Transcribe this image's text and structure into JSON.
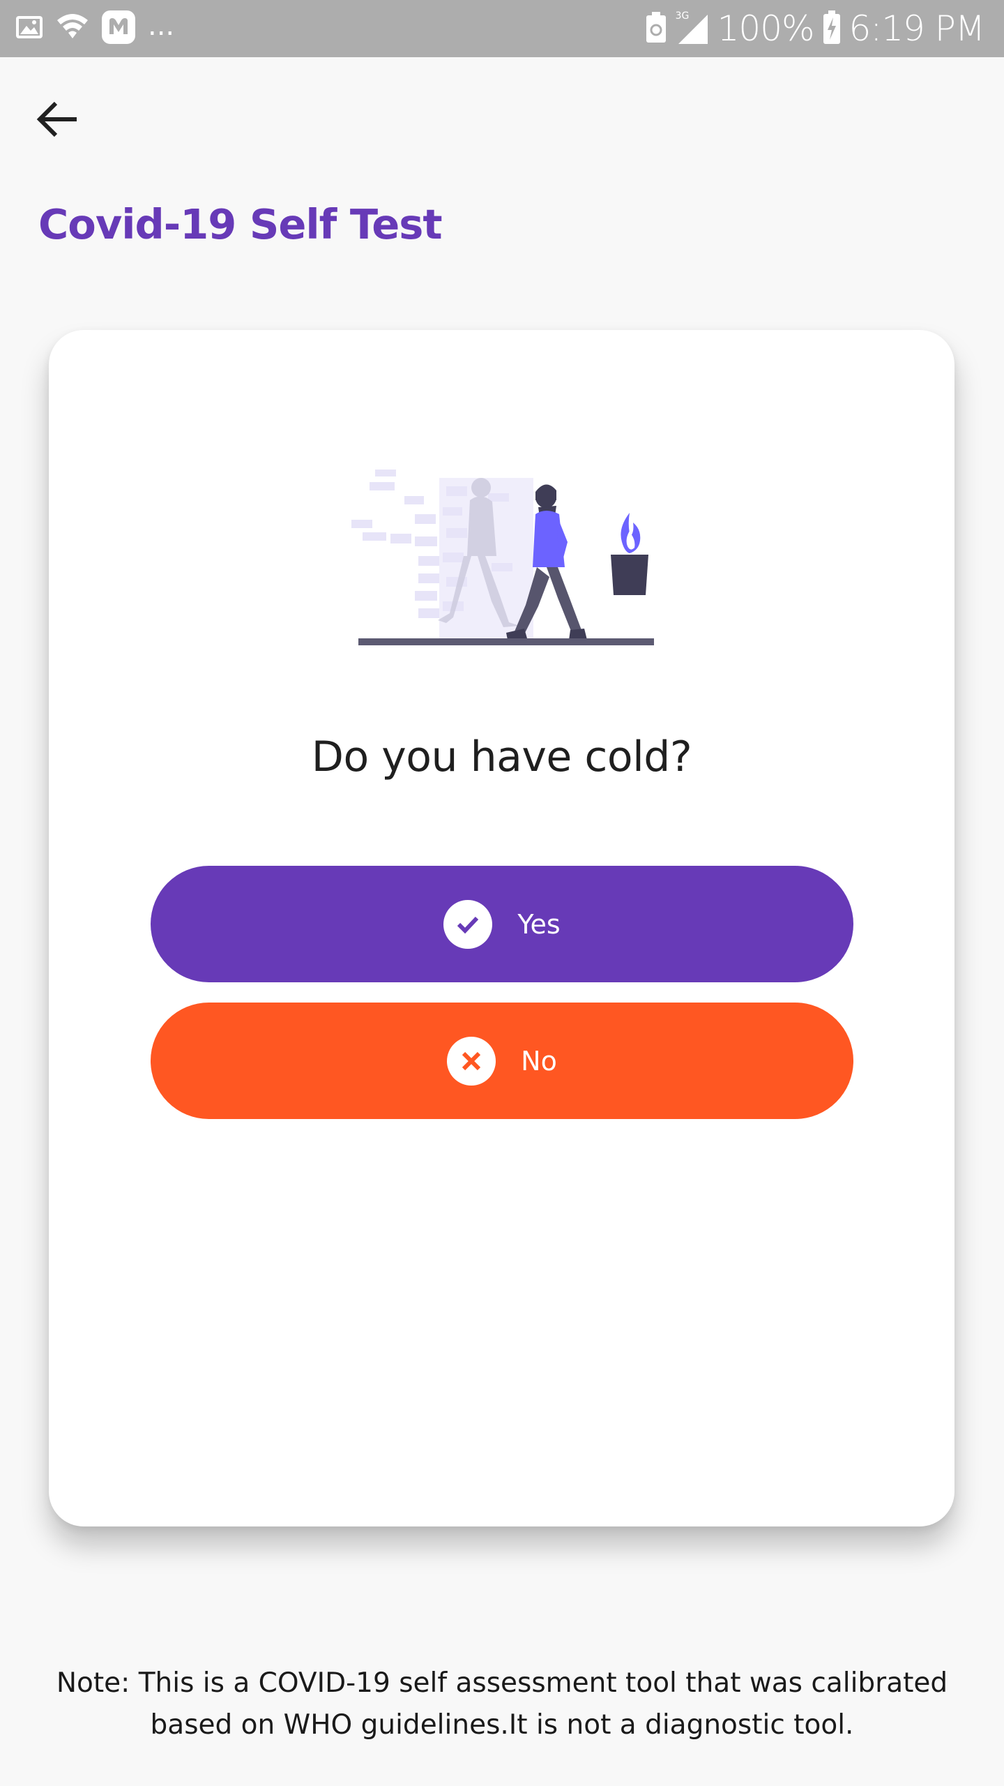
{
  "status_bar": {
    "battery": "100%",
    "time": "6:19 PM",
    "network": "3G",
    "more": "...",
    "icons": [
      "gallery-icon",
      "wifi-icon",
      "app-notification-icon",
      "battery-saver-icon",
      "signal-icon",
      "battery-charging-icon"
    ]
  },
  "header": {
    "back_icon": "arrow-left-icon",
    "title": "Covid-19 Self Test"
  },
  "card": {
    "illustration": "person-walking-cold-illustration",
    "question": "Do you have cold?",
    "yes": {
      "label": "Yes",
      "icon": "check-circle-icon"
    },
    "no": {
      "label": "No",
      "icon": "close-circle-icon"
    }
  },
  "footer": {
    "note_line1": "Note: This is a COVID-19 self assessment tool that was calibrated",
    "note_line2": "based on WHO guidelines.It is not a diagnostic tool."
  },
  "colors": {
    "primary": "#673ab7",
    "accent": "#ff5722",
    "status_bar": "#adadad",
    "background": "#f8f8f8"
  }
}
